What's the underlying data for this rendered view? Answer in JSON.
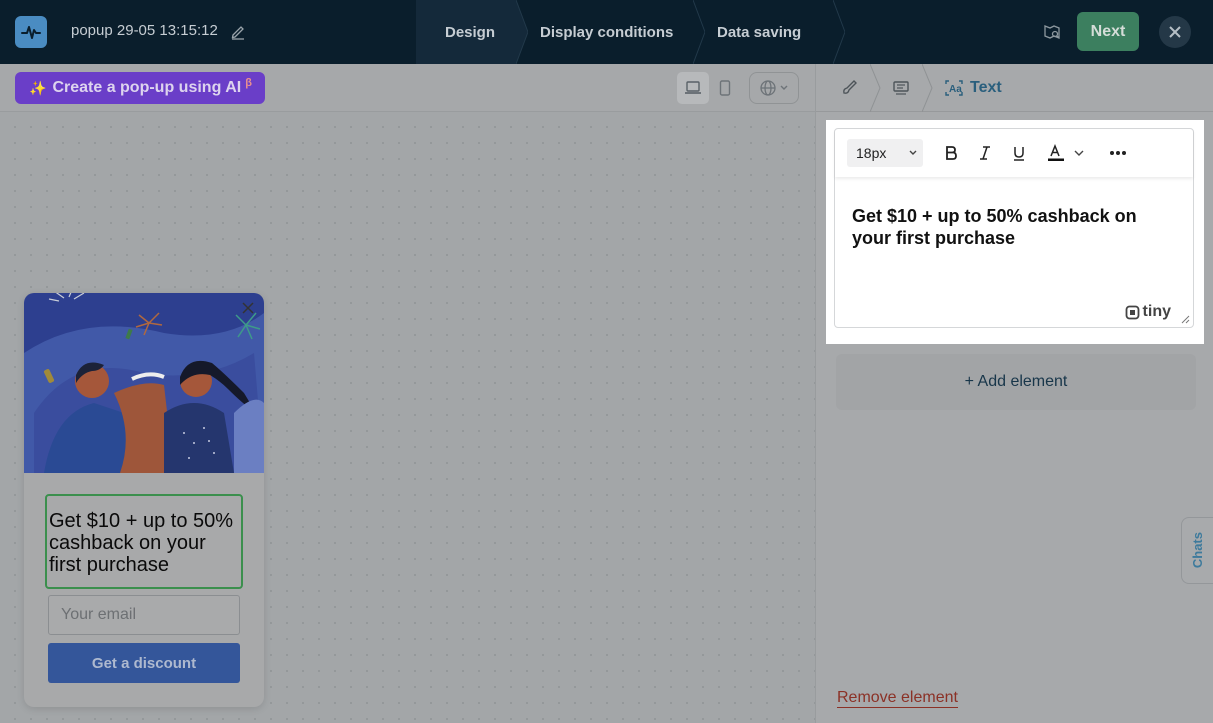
{
  "topbar": {
    "title": "popup 29-05 13:15:12",
    "steps": [
      {
        "label": "Design",
        "active": true
      },
      {
        "label": "Display conditions",
        "active": false
      },
      {
        "label": "Data saving",
        "active": false
      }
    ],
    "next_label": "Next"
  },
  "canvas": {
    "ai_button_label": "Create a pop-up using AI",
    "ai_beta": "β"
  },
  "popup": {
    "headline": "Get $10 + up to 50% cashback on your first purchase",
    "email_placeholder": "Your email",
    "button_label": "Get a discount"
  },
  "panel": {
    "breadcrumb_active": "Text",
    "editor": {
      "font_size": "18px",
      "content": "Get $10 + up to 50% cashback on your first purchase",
      "brand": "tiny"
    },
    "add_element_label": "+ Add element",
    "remove_element_label": "Remove element"
  },
  "chats_label": "Chats",
  "icons": [
    "pulse-logo-icon",
    "pencil-icon",
    "preview-icon",
    "close-icon",
    "laptop-icon",
    "mobile-icon",
    "globe-icon",
    "chevron-down-icon",
    "brush-icon",
    "form-icon",
    "text-icon",
    "bold-icon",
    "italic-icon",
    "underline-icon",
    "text-color-icon",
    "more-icon",
    "resize-icon"
  ],
  "colors": {
    "topbar_bg": "#0a1e2c",
    "next_button": "#3c7f5f",
    "ai_button": "#6a3ec8",
    "popup_button": "#34569a",
    "headline_border": "#3b8f4d",
    "remove_link": "#8b3126"
  }
}
